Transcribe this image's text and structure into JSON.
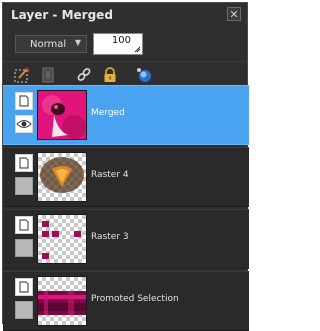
{
  "window": {
    "title": "Layer - Merged",
    "close_glyph": "✕"
  },
  "controls": {
    "blend_mode": "Normal",
    "blend_chevron": "▼",
    "opacity": "100"
  },
  "toolbar": [
    {
      "name": "edit-layer-icon"
    },
    {
      "name": "mask-icon"
    },
    {
      "name": "link-icon"
    },
    {
      "name": "lock-icon"
    },
    {
      "name": "layer-style-icon"
    }
  ],
  "layers": [
    {
      "name": "Merged",
      "selected": true,
      "visible": true
    },
    {
      "name": "Raster 4",
      "selected": false,
      "visible": false
    },
    {
      "name": "Raster 3",
      "selected": false,
      "visible": false
    },
    {
      "name": "Promoted Selection",
      "selected": false,
      "visible": false
    }
  ],
  "colors": {
    "panel_bg": "#2f2f2f",
    "selected_row": "#4aa3f0",
    "accent_pink": "#e0147a",
    "accent_magenta": "#9c0b55"
  }
}
